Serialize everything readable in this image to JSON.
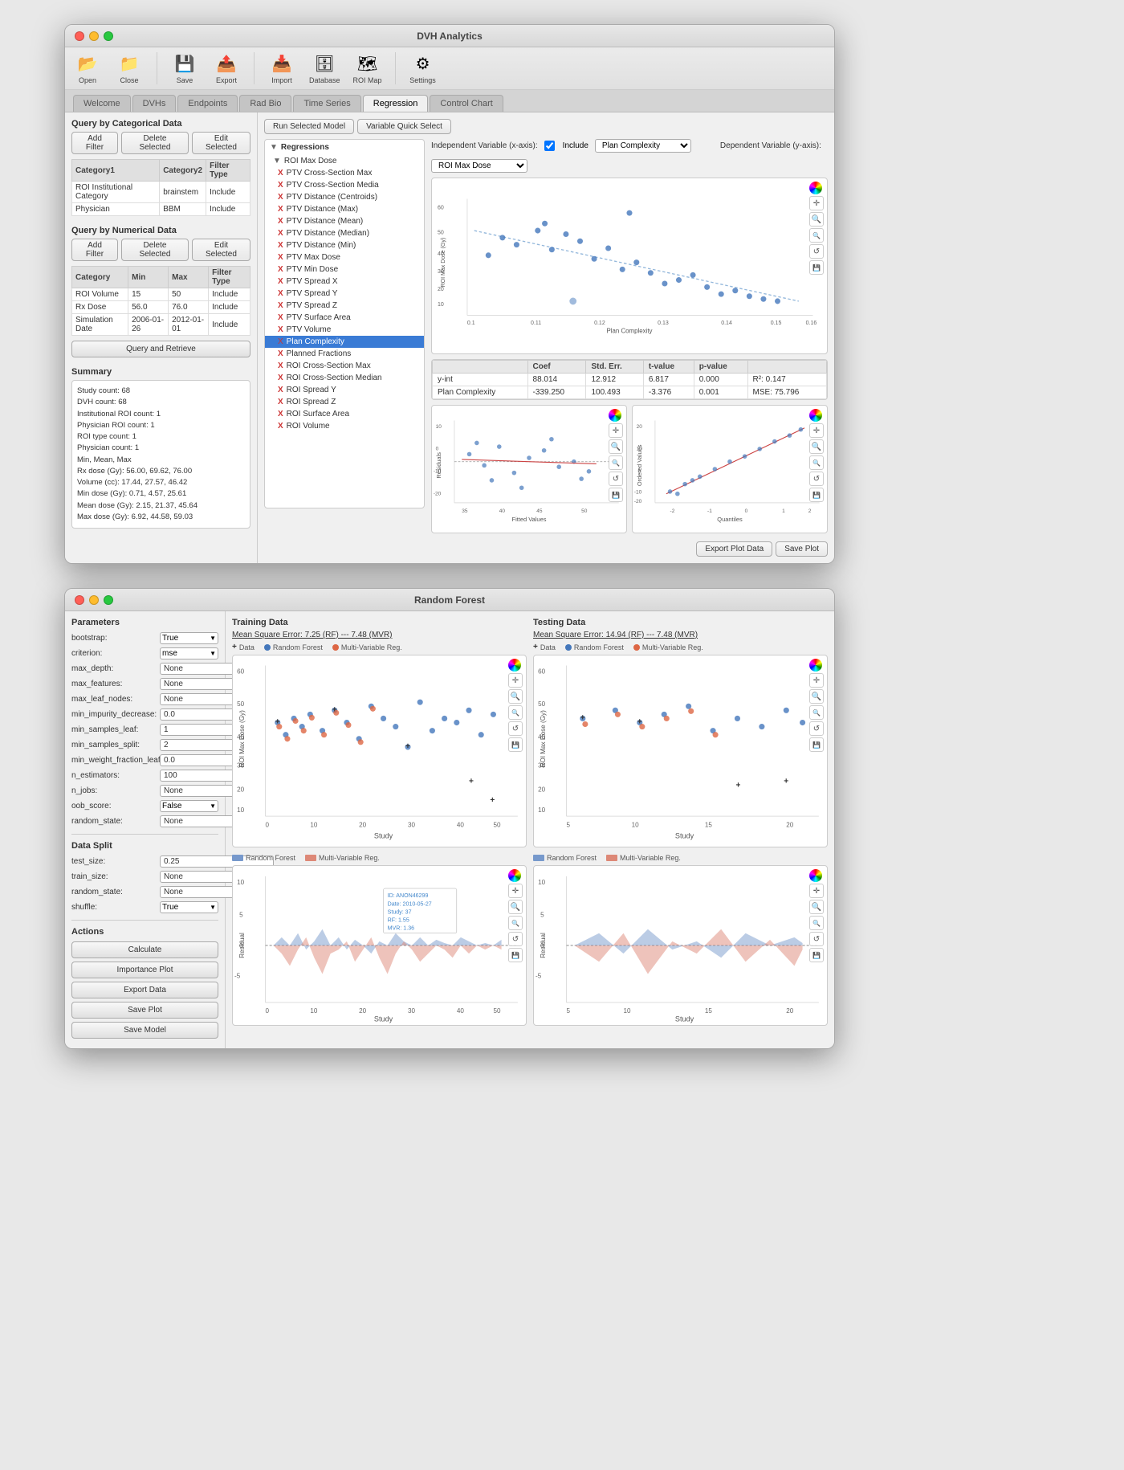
{
  "app1": {
    "title": "DVH Analytics",
    "tabs": [
      "Welcome",
      "DVHs",
      "Endpoints",
      "Rad Bio",
      "Time Series",
      "Regression",
      "Control Chart"
    ],
    "active_tab": "Regression",
    "toolbar": {
      "items": [
        {
          "label": "Open",
          "icon": "📂"
        },
        {
          "label": "Close",
          "icon": "📁"
        },
        {
          "label": "Save",
          "icon": "💾"
        },
        {
          "label": "Export",
          "icon": "📤"
        },
        {
          "label": "Import",
          "icon": "📥"
        },
        {
          "label": "Database",
          "icon": "🗄"
        },
        {
          "label": "ROI Map",
          "icon": "🗺"
        },
        {
          "label": "Settings",
          "icon": "⚙"
        }
      ]
    },
    "left": {
      "categorical_title": "Query by Categorical Data",
      "categorical_buttons": [
        "Add Filter",
        "Delete Selected",
        "Edit Selected"
      ],
      "cat_headers": [
        "Category1",
        "Category2",
        "Filter Type"
      ],
      "cat_rows": [
        [
          "ROI Institutional Category",
          "brainstem",
          "Include"
        ],
        [
          "Physician",
          "BBM",
          "Include"
        ]
      ],
      "numerical_title": "Query by Numerical Data",
      "num_buttons": [
        "Add Filter",
        "Delete Selected",
        "Edit Selected"
      ],
      "num_headers": [
        "Category",
        "Min",
        "Max",
        "Filter Type"
      ],
      "num_rows": [
        [
          "ROI Volume",
          "15",
          "50",
          "Include"
        ],
        [
          "Rx Dose",
          "56.0",
          "76.0",
          "Include"
        ],
        [
          "Simulation Date",
          "2006-01-26",
          "2012-01-01",
          "Include"
        ]
      ],
      "query_btn": "Query and Retrieve",
      "summary_title": "Summary",
      "summary_lines": [
        "Study count: 68",
        "DVH count: 68",
        "Institutional ROI count: 1",
        "Physician ROI count: 1",
        "ROI type count: 1",
        "Physician count: 1",
        "",
        "Min, Mean, Max",
        "Rx dose (Gy): 56.00, 69.62, 76.00",
        "Volume (cc): 17.44, 27.57, 46.42",
        "Min dose (Gy): 0.71, 4.57, 25.61",
        "Mean dose (Gy): 2.15, 21.37, 45.64",
        "Max dose (Gy): 6.92, 44.58, 59.03"
      ]
    },
    "right": {
      "run_model_btn": "Run Selected Model",
      "quick_select_btn": "Variable Quick Select",
      "reg_label": "Regressions",
      "tree_root": "ROI Max Dose",
      "tree_items": [
        "PTV Cross-Section Max",
        "PTV Cross-Section Media",
        "PTV Distance (Centroids)",
        "PTV Distance (Max)",
        "PTV Distance (Mean)",
        "PTV Distance (Median)",
        "PTV Distance (Min)",
        "PTV Max Dose",
        "PTV Min Dose",
        "PTV Spread X",
        "PTV Spread Y",
        "PTV Spread Z",
        "PTV Surface Area",
        "PTV Volume",
        "Plan Complexity",
        "Planned Fractions",
        "ROI Cross-Section Max",
        "ROI Cross-Section Median",
        "ROI Spread Y",
        "ROI Spread Z",
        "ROI Surface Area",
        "ROI Volume"
      ],
      "selected_item": "Plan Complexity",
      "indep_label": "Independent Variable (x-axis):",
      "include_label": "Include",
      "indep_value": "Plan Complexity",
      "dep_label": "Dependent Variable (y-axis):",
      "dep_value": "ROI Max Dose",
      "chart_x_label": "Plan Complexity",
      "chart_y_label": "ROI Max Dose (Gy)",
      "stat_headers": [
        "",
        "Coef",
        "Std. Err.",
        "t-value",
        "p-value",
        ""
      ],
      "stat_rows": [
        [
          "y-int",
          "88.014",
          "12.912",
          "6.817",
          "0.000",
          "R²: 0.147"
        ],
        [
          "Plan Complexity",
          "-339.250",
          "100.493",
          "-3.376",
          "0.001",
          "MSE: 75.796"
        ]
      ],
      "export_btn": "Export Plot Data",
      "save_plot_btn": "Save Plot",
      "fitted_label": "Fitted Values",
      "quantiles_label": "Quantiles",
      "residuals_label": "Residuals",
      "ordered_label": "Ordered Values"
    }
  },
  "app2": {
    "title": "Random Forest",
    "params_title": "Parameters",
    "params": [
      {
        "label": "bootstrap:",
        "value": "True",
        "is_select": true
      },
      {
        "label": "criterion:",
        "value": "mse",
        "is_select": true
      },
      {
        "label": "max_depth:",
        "value": "None",
        "is_select": false
      },
      {
        "label": "max_features:",
        "value": "None",
        "is_select": false
      },
      {
        "label": "max_leaf_nodes:",
        "value": "None",
        "is_select": false
      },
      {
        "label": "min_impurity_decrease:",
        "value": "0.0",
        "is_select": false
      },
      {
        "label": "min_samples_leaf:",
        "value": "1",
        "is_select": false
      },
      {
        "label": "min_samples_split:",
        "value": "2",
        "is_select": false
      },
      {
        "label": "min_weight_fraction_leaf:",
        "value": "0.0",
        "is_select": false
      },
      {
        "label": "n_estimators:",
        "value": "100",
        "is_select": false
      },
      {
        "label": "n_jobs:",
        "value": "None",
        "is_select": false
      },
      {
        "label": "oob_score:",
        "value": "False",
        "is_select": true
      },
      {
        "label": "random_state:",
        "value": "None",
        "is_select": false
      }
    ],
    "data_split_title": "Data Split",
    "data_split": [
      {
        "label": "test_size:",
        "value": "0.25",
        "is_select": false
      },
      {
        "label": "train_size:",
        "value": "None",
        "is_select": false
      },
      {
        "label": "random_state:",
        "value": "None",
        "is_select": false
      },
      {
        "label": "shuffle:",
        "value": "True",
        "is_select": true
      }
    ],
    "actions_title": "Actions",
    "action_btns": [
      "Calculate",
      "Importance Plot",
      "Export Data",
      "Save Plot",
      "Save Model"
    ],
    "training": {
      "title": "Training Data",
      "mse": "Mean Square Error: 7.25 (RF) --- 7.48 (MVR)",
      "x_label": "Study",
      "y_label": "ROI Max Dose (Gy)"
    },
    "testing": {
      "title": "Testing Data",
      "mse": "Mean Square Error: 14.94 (RF) --- 7.48 (MVR)",
      "x_label": "Study",
      "y_label": "ROI Max Dose (Gy)"
    },
    "legend": {
      "data_label": "Data",
      "rf_label": "Random Forest",
      "mvr_label": "Multi-Variable Reg."
    },
    "residual_legend": {
      "rf_label": "Random Forest",
      "mvr_label": "Multi-Variable Reg."
    },
    "residual": {
      "x_label": "Study",
      "y_label": "Residual"
    },
    "tooltip": {
      "id": "ID: ANON46299",
      "date": "Date: 2010-05-27",
      "study": "Study: 37",
      "rf": "RF: 1.55",
      "mvr": "MVR: 1.36"
    }
  }
}
